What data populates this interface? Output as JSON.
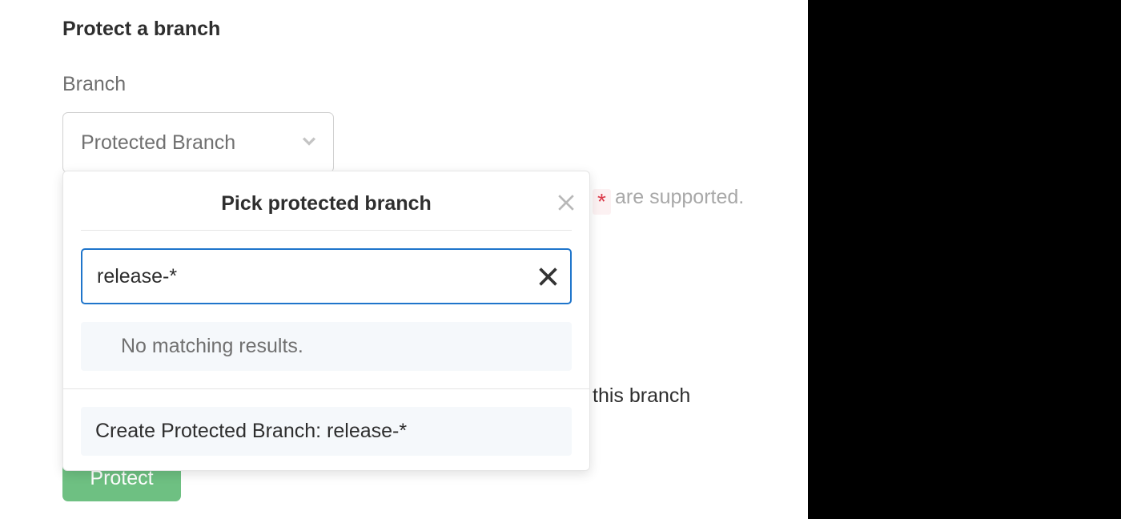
{
  "section_title": "Protect a branch",
  "branch_label": "Branch",
  "dropdown_placeholder": "Protected Branch",
  "dropdown": {
    "title": "Pick protected branch",
    "search_value": "release-*",
    "no_results": "No matching results.",
    "create_option": "Create Protected Branch: release-*"
  },
  "behind": {
    "wildcard": "*",
    "supported": " are supported.",
    "this_branch": "this branch"
  },
  "protect_button": "Protect"
}
